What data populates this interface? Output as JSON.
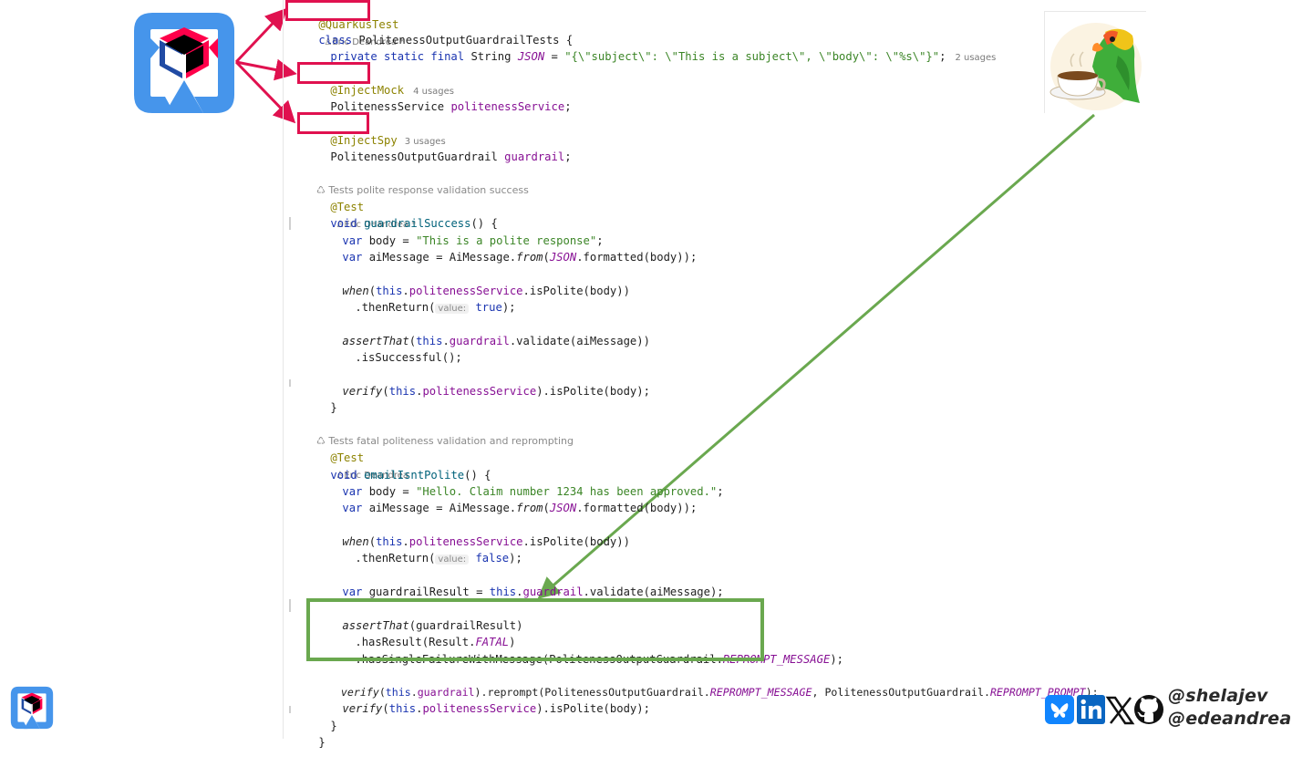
{
  "code": {
    "line1": {
      "annotation": "@QuarkusTest",
      "author": "Eric Deandrea *"
    },
    "line2": {
      "kw": "class",
      "name": "PolitenessOutputGuardrailTests {"
    },
    "line3": {
      "mods": "private static final",
      "type": "String",
      "field": "JSON",
      "eq": " = ",
      "value": "\"{\\\"subject\\\": \\\"This is a subject\\\", \\\"body\\\": \\\"%s\\\"}\"",
      "semi": ";",
      "usages": "2 usages"
    },
    "line4": {
      "annotation": "@InjectMock",
      "usages": "4 usages"
    },
    "line5": {
      "type": "PolitenessService",
      "field": "politenessService",
      "semi": ";"
    },
    "line6": {
      "annotation": "@InjectSpy",
      "usages": "3 usages"
    },
    "line7": {
      "type": "PolitenessOutputGuardrail",
      "field": "guardrail",
      "semi": ";"
    },
    "line8": {
      "comment": "Tests polite response validation success"
    },
    "line9": {
      "annotation": "@Test",
      "author": "Eric Deandrea *"
    },
    "line10": {
      "kw": "void",
      "name": "guardrailSuccess",
      "rest": "() {"
    },
    "line11": {
      "kw": "var",
      "rest": " body = ",
      "str": "\"This is a polite response\"",
      "semi": ";"
    },
    "line12": {
      "kw": "var",
      "rest": " aiMessage = AiMessage.",
      "method": "from",
      "p1": "(",
      "field": "JSON",
      "rest2": ".formatted(body));"
    },
    "line13": {
      "method": "when",
      "p1": "(",
      "kw": "this",
      "dot": ".",
      "field": "politenessService",
      "rest": ".isPolite(body))"
    },
    "line14": {
      "pre": ".thenReturn(",
      "hint": "value:",
      "kw": "true",
      "rest": ");"
    },
    "line15": {
      "method": "assertThat",
      "p1": "(",
      "kw": "this",
      "dot": ".",
      "field": "guardrail",
      "rest": ".validate(aiMessage))"
    },
    "line16": {
      "rest": ".isSuccessful();"
    },
    "line17": {
      "method": "verify",
      "p1": "(",
      "kw": "this",
      "dot": ".",
      "field": "politenessService",
      "rest": ").isPolite(body);"
    },
    "line18": {
      "rest": "}"
    },
    "line19": {
      "comment": "Tests fatal politeness validation and reprompting"
    },
    "line20": {
      "annotation": "@Test",
      "author": "Eric Deandrea"
    },
    "line21": {
      "kw": "void",
      "name": "emailIsntPolite",
      "rest": "() {"
    },
    "line22": {
      "kw": "var",
      "rest": " body = ",
      "str": "\"Hello. Claim number 1234 has been approved.\"",
      "semi": ";"
    },
    "line23": {
      "kw": "var",
      "rest": " aiMessage = AiMessage.",
      "method": "from",
      "p1": "(",
      "field": "JSON",
      "rest2": ".formatted(body));"
    },
    "line24": {
      "method": "when",
      "p1": "(",
      "kw": "this",
      "dot": ".",
      "field": "politenessService",
      "rest": ".isPolite(body))"
    },
    "line25": {
      "pre": ".thenReturn(",
      "hint": "value:",
      "kw": "false",
      "rest": ");"
    },
    "line26": {
      "kw": "var",
      "rest": " guardrailResult = ",
      "kw2": "this",
      "dot": ".",
      "field": "guardrail",
      "rest2": ".validate(aiMessage);"
    },
    "line27": {
      "method": "assertThat",
      "rest": "(guardrailResult)"
    },
    "line28": {
      "pre": ".hasResult(Result.",
      "field": "FATAL",
      "rest": ")"
    },
    "line29": {
      "pre": ".hasSingleFailureWithMessage(PolitenessOutputGuardrail.",
      "field": "REPROMPT_MESSAGE",
      "rest": ");"
    },
    "line30": {
      "method": "verify",
      "p1": "(",
      "kw": "this",
      "dot": ".",
      "field": "guardrail",
      "rest": ").reprompt(PolitenessOutputGuardrail.",
      "field2": "REPROMPT_MESSAGE",
      "rest2": ", PolitenessOutputGuardrail.",
      "field3": "REPROMPT_PROMPT",
      "rest3": ");"
    },
    "line31": {
      "method": "verify",
      "p1": "(",
      "kw": "this",
      "dot": ".",
      "field": "politenessService",
      "rest": ").isPolite(body);"
    },
    "line32": {
      "rest": "}"
    },
    "line33": {
      "rest": "}"
    }
  },
  "social": {
    "handle1": "@shelajev",
    "handle2": "@edeandrea",
    "icons": [
      "bluesky-icon",
      "linkedin-icon",
      "x-icon",
      "github-icon"
    ]
  },
  "colors": {
    "red_highlight": "#e0114f",
    "green_highlight": "#6aa84f",
    "quarkus_blue": "#4695eb",
    "quarkus_red": "#ff004a"
  }
}
